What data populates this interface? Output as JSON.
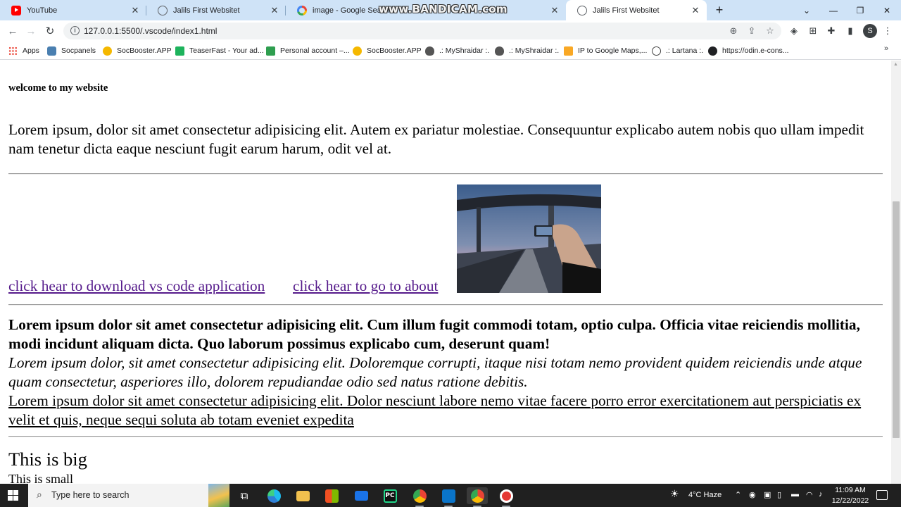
{
  "browser": {
    "tabs": [
      {
        "title": "YouTube",
        "favicon": "youtube-icon",
        "active": false
      },
      {
        "title": "Jalils First Websitet",
        "favicon": "globe-icon",
        "active": false
      },
      {
        "title": "image - Google Search",
        "favicon": "google-icon",
        "active": false
      },
      {
        "title": "Jalils First Websitet",
        "favicon": "globe-icon",
        "active": true
      }
    ],
    "watermark": "www.BANDICAM.com",
    "url": "127.0.0.1:5500/.vscode/index1.html",
    "profile_initial": "S",
    "colors": {
      "tabstrip": "#cfe3f7",
      "visited_link": "#551a8b"
    }
  },
  "bookmarks": [
    {
      "label": "Apps",
      "icon": "apps-grid-icon"
    },
    {
      "label": "Socpanels",
      "icon": "socpanels-icon"
    },
    {
      "label": "SocBooster.APP",
      "icon": "coin-icon"
    },
    {
      "label": "TeaserFast - Your ad...",
      "icon": "teaserfast-icon"
    },
    {
      "label": "Personal account –...",
      "icon": "folder-icon"
    },
    {
      "label": "SocBooster.APP",
      "icon": "coin-icon"
    },
    {
      "label": ".: MyShraidar :.",
      "icon": "alien-icon"
    },
    {
      "label": ".: MyShraidar :.",
      "icon": "alien-icon"
    },
    {
      "label": "IP to Google Maps,...",
      "icon": "ip-icon"
    },
    {
      "label": ".: Lartana :.",
      "icon": "target-icon"
    },
    {
      "label": "https://odin.e-cons...",
      "icon": "globe-icon"
    }
  ],
  "page": {
    "welcome": "welcome to my website",
    "para1": "Lorem ipsum, dolor sit amet consectetur adipisicing elit. Autem ex pariatur molestiae. Consequuntur explicabo autem nobis quo ullam impedit nam tenetur dicta eaque nesciunt fugit earum harum, odit vel at.",
    "link_download": "click hear to download vs code application",
    "link_about": "click hear to go to about",
    "para_bold": "Lorem ipsum dolor sit amet consectetur adipisicing elit. Cum illum fugit commodi totam, optio culpa. Officia vitae reiciendis mollitia, modi incidunt aliquam dicta. Quo laborum possimus explicabo cum, deserunt quam!",
    "para_italic": "Lorem ipsum dolor, sit amet consectetur adipisicing elit. Doloremque corrupti, itaque nisi totam nemo provident quidem reiciendis unde atque quam consectetur, asperiores illo, dolorem repudiandae odio sed natus ratione debitis.",
    "para_underline": "Lorem ipsum dolor sit amet consectetur adipisicing elit. Dolor nesciunt labore nemo vitae facere porro error exercitationem aut perspiciatis ex velit et quis, neque sequi soluta ab totam eveniet expedita",
    "big_text": "This is big",
    "small_text": "This is small"
  },
  "taskbar": {
    "search_placeholder": "Type here to search",
    "apps": [
      "task-view-icon",
      "edge-icon",
      "file-explorer-icon",
      "store-icon",
      "mail-icon",
      "pycharm-icon",
      "chrome-icon",
      "vscode-icon",
      "chrome-icon",
      "bandicam-record-icon"
    ],
    "weather": "4°C  Haze",
    "time": "11:09 AM",
    "date": "12/22/2022"
  }
}
